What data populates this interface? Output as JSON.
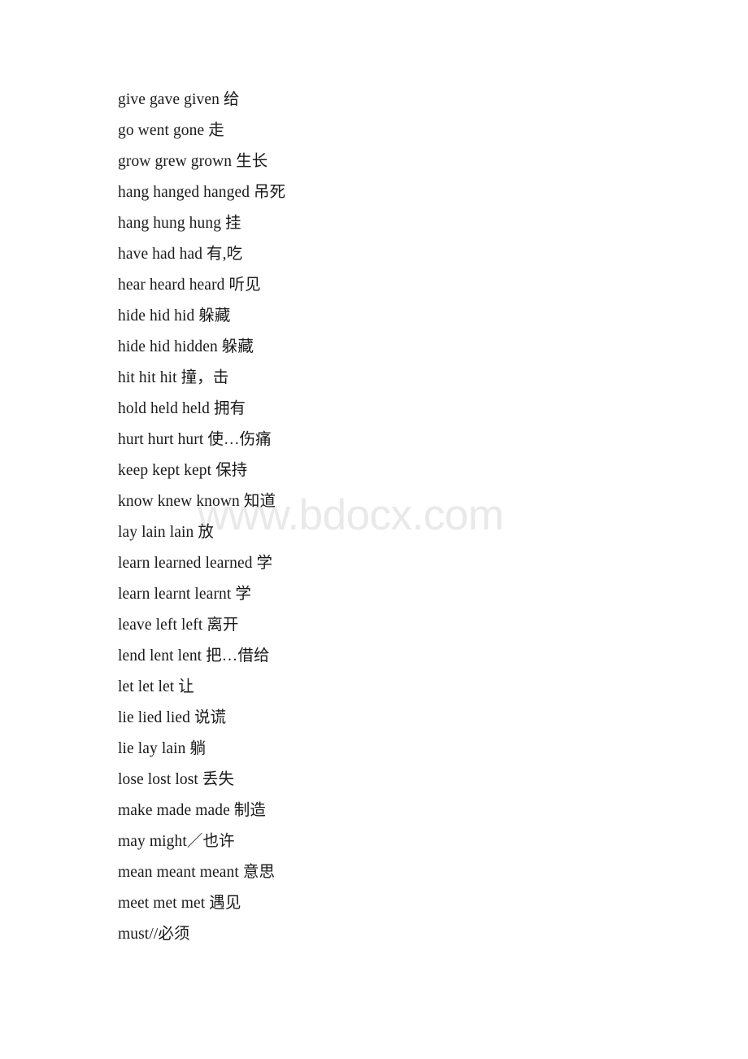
{
  "document": {
    "watermark": "www.bdocx.com",
    "watermark_color": "#e9e9e9",
    "text_color": "#1a1a1a",
    "background_color": "#ffffff"
  },
  "verb_list": {
    "lines": [
      "give gave given 给",
      "go went gone 走",
      "grow grew grown 生长",
      "hang hanged hanged 吊死",
      "hang hung hung 挂",
      "have had had 有,吃",
      "hear heard heard 听见",
      "hide hid hid 躲藏",
      "hide hid hidden 躲藏",
      "hit hit hit 撞，击",
      "hold held held 拥有",
      "hurt hurt hurt 使…伤痛",
      "keep kept kept 保持",
      "know knew known 知道",
      "lay lain lain 放",
      "learn learned learned 学",
      "learn learnt learnt 学",
      "leave left left 离开",
      "lend lent lent 把…借给",
      "let let let 让",
      "lie lied lied 说谎",
      "lie lay lain 躺",
      "lose lost lost 丢失",
      "make made made 制造",
      "may might／也许",
      "mean meant meant 意思",
      "meet met met 遇见",
      "must//必须"
    ]
  }
}
